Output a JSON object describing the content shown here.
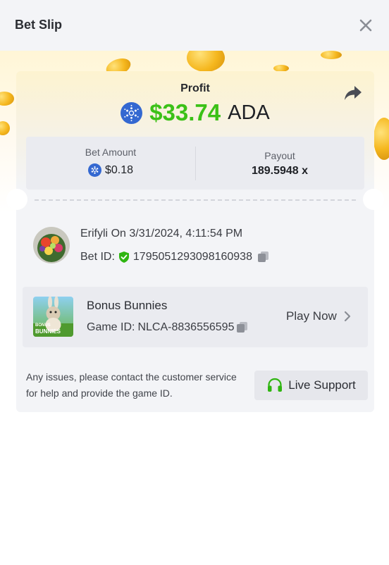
{
  "header": {
    "title": "Bet Slip",
    "close_icon": "close-icon"
  },
  "profit": {
    "label": "Profit",
    "value": "$33.74",
    "currency": "ADA",
    "coin_icon": "cardano-icon",
    "share_icon": "share-arrow-icon"
  },
  "stats": {
    "bet_amount_label": "Bet Amount",
    "bet_amount_value": "$0.18",
    "payout_label": "Payout",
    "payout_value": "189.5948 x"
  },
  "bet": {
    "username": "Erifyli",
    "on_text": "On 3/31/2024, 4:11:54 PM",
    "bet_id_label": "Bet ID:",
    "bet_id": "1795051293098160938"
  },
  "game": {
    "name": "Bonus Bunnies",
    "game_id_label": "Game ID:",
    "game_id": "NLCA-8836556595",
    "play_label": "Play Now",
    "thumb_text": [
      "BONUS",
      "BUNNIES"
    ]
  },
  "footer": {
    "help_text": "Any issues, please contact the customer service for help and provide the game ID.",
    "support_label": "Live Support"
  },
  "colors": {
    "profit_green": "#3bc117",
    "cardano_blue": "#3468d1",
    "support_green": "#2fb511",
    "background": "#f3f4f7"
  }
}
